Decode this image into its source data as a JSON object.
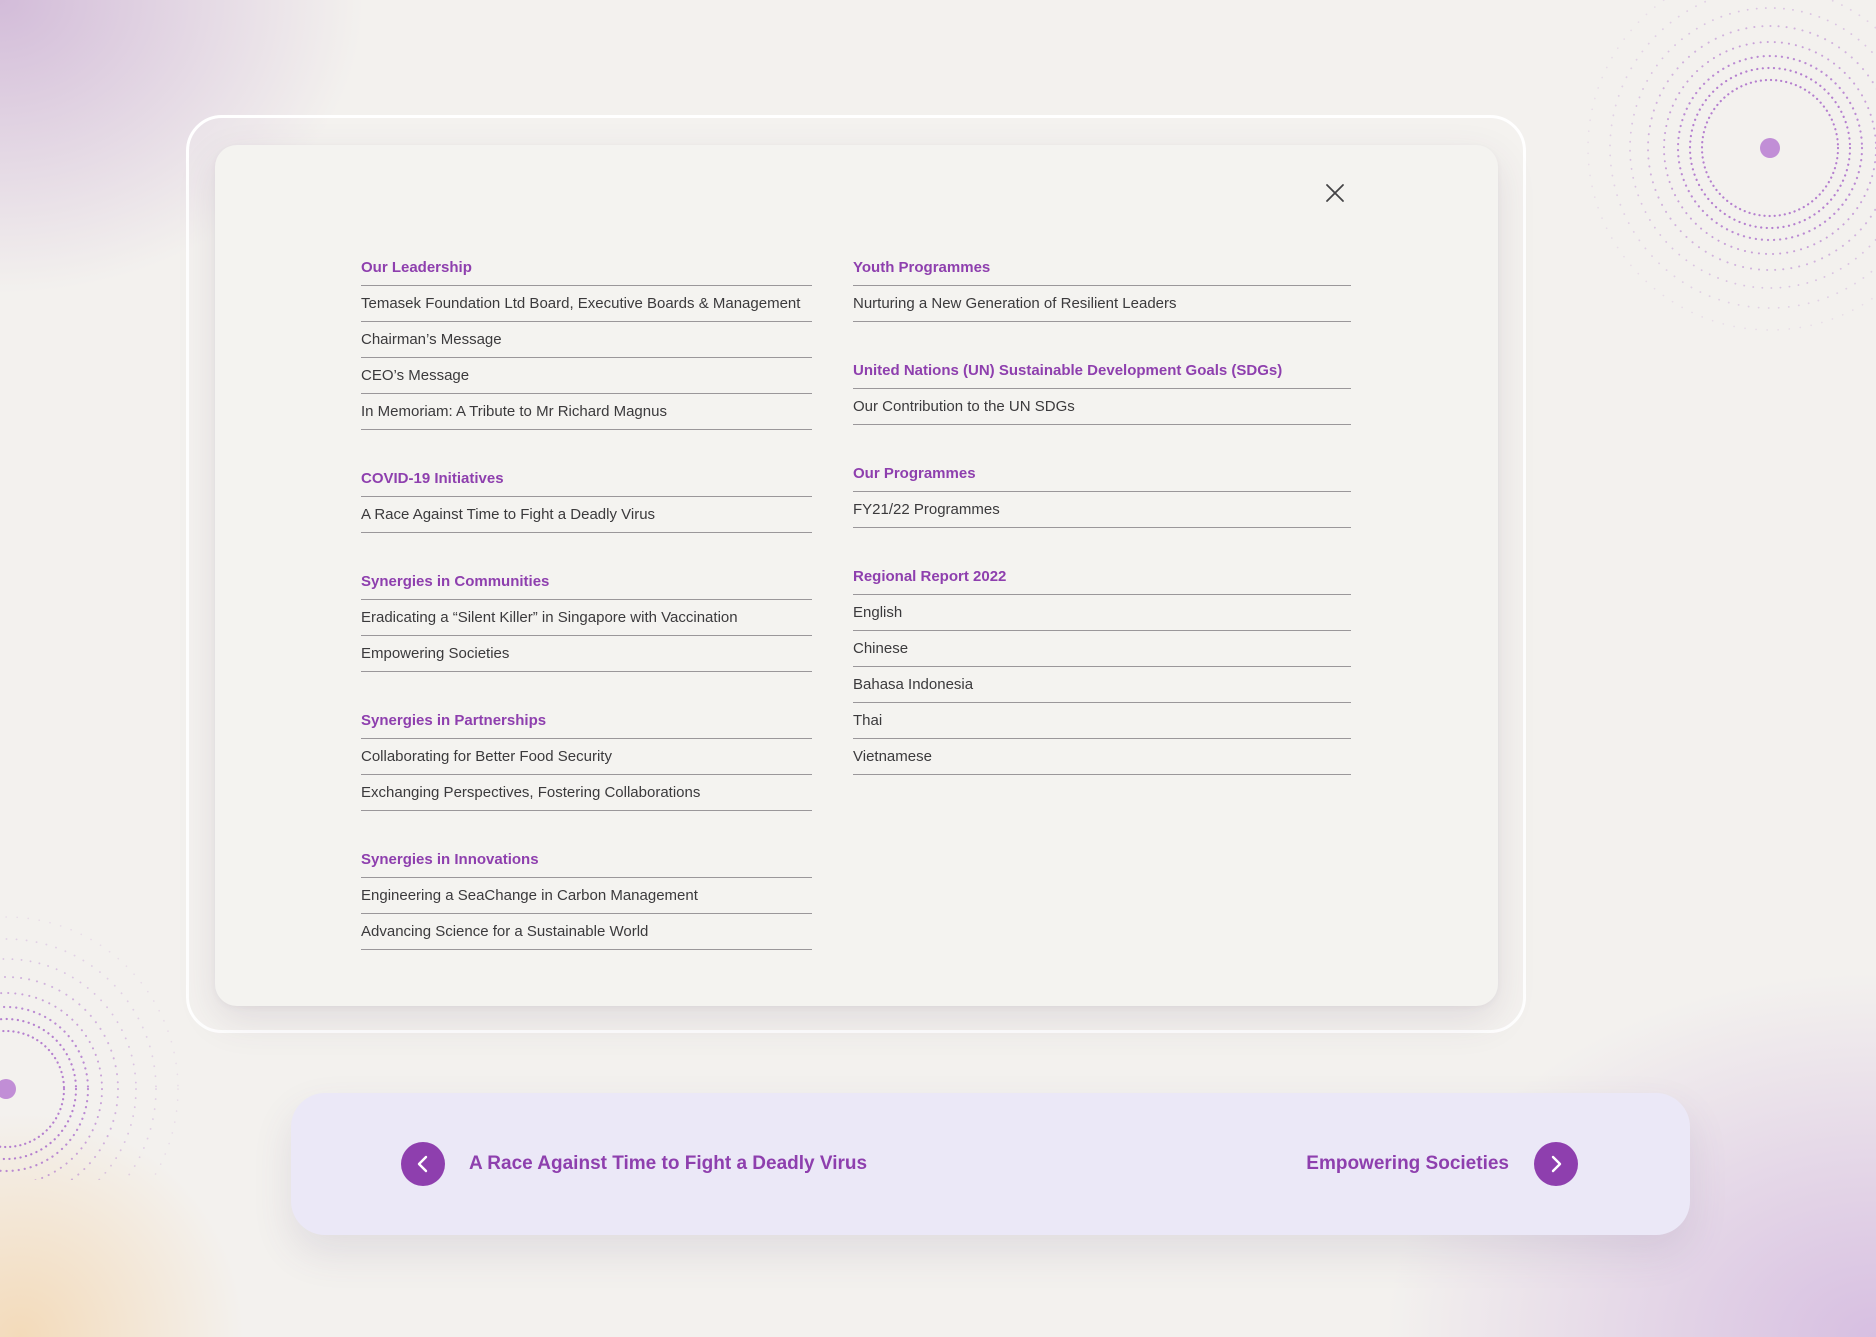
{
  "menu": {
    "left_sections": [
      {
        "title": "Our Leadership",
        "items": [
          "Temasek Foundation Ltd Board, Executive Boards & Management",
          "Chairman’s Message",
          "CEO’s Message",
          "In Memoriam: A Tribute to Mr Richard Magnus"
        ]
      },
      {
        "title": "COVID-19 Initiatives",
        "items": [
          "A Race Against Time to Fight a Deadly Virus"
        ]
      },
      {
        "title": "Synergies in Communities",
        "items": [
          "Eradicating a “Silent Killer” in Singapore with Vaccination",
          "Empowering Societies"
        ]
      },
      {
        "title": "Synergies in Partnerships",
        "items": [
          "Collaborating for Better Food Security",
          "Exchanging Perspectives, Fostering Collaborations"
        ]
      },
      {
        "title": "Synergies in Innovations",
        "items": [
          "Engineering a SeaChange in Carbon Management",
          "Advancing Science for a Sustainable World"
        ]
      }
    ],
    "right_sections": [
      {
        "title": "Youth Programmes",
        "items": [
          "Nurturing a New Generation of Resilient Leaders"
        ]
      },
      {
        "title": "United Nations (UN) Sustainable Development Goals (SDGs)",
        "items": [
          "Our Contribution to the UN SDGs"
        ]
      },
      {
        "title": "Our Programmes",
        "items": [
          "FY21/22 Programmes"
        ]
      },
      {
        "title": "Regional Report 2022",
        "items": [
          "English",
          "Chinese",
          "Bahasa Indonesia",
          "Thai",
          "Vietnamese"
        ]
      }
    ]
  },
  "pager": {
    "prev_label": "A Race Against Time to Fight a Deadly Virus",
    "next_label": "Empowering Societies"
  },
  "icons": {
    "close": "close-icon",
    "prev": "chevron-left-icon",
    "next": "chevron-right-icon"
  },
  "colors": {
    "accent": "#8e3fae",
    "text": "#3b3a3c",
    "divider": "#9a979a",
    "nav_bar_bg": "#ebe8f7",
    "modal_bg": "#f4f3f0"
  }
}
